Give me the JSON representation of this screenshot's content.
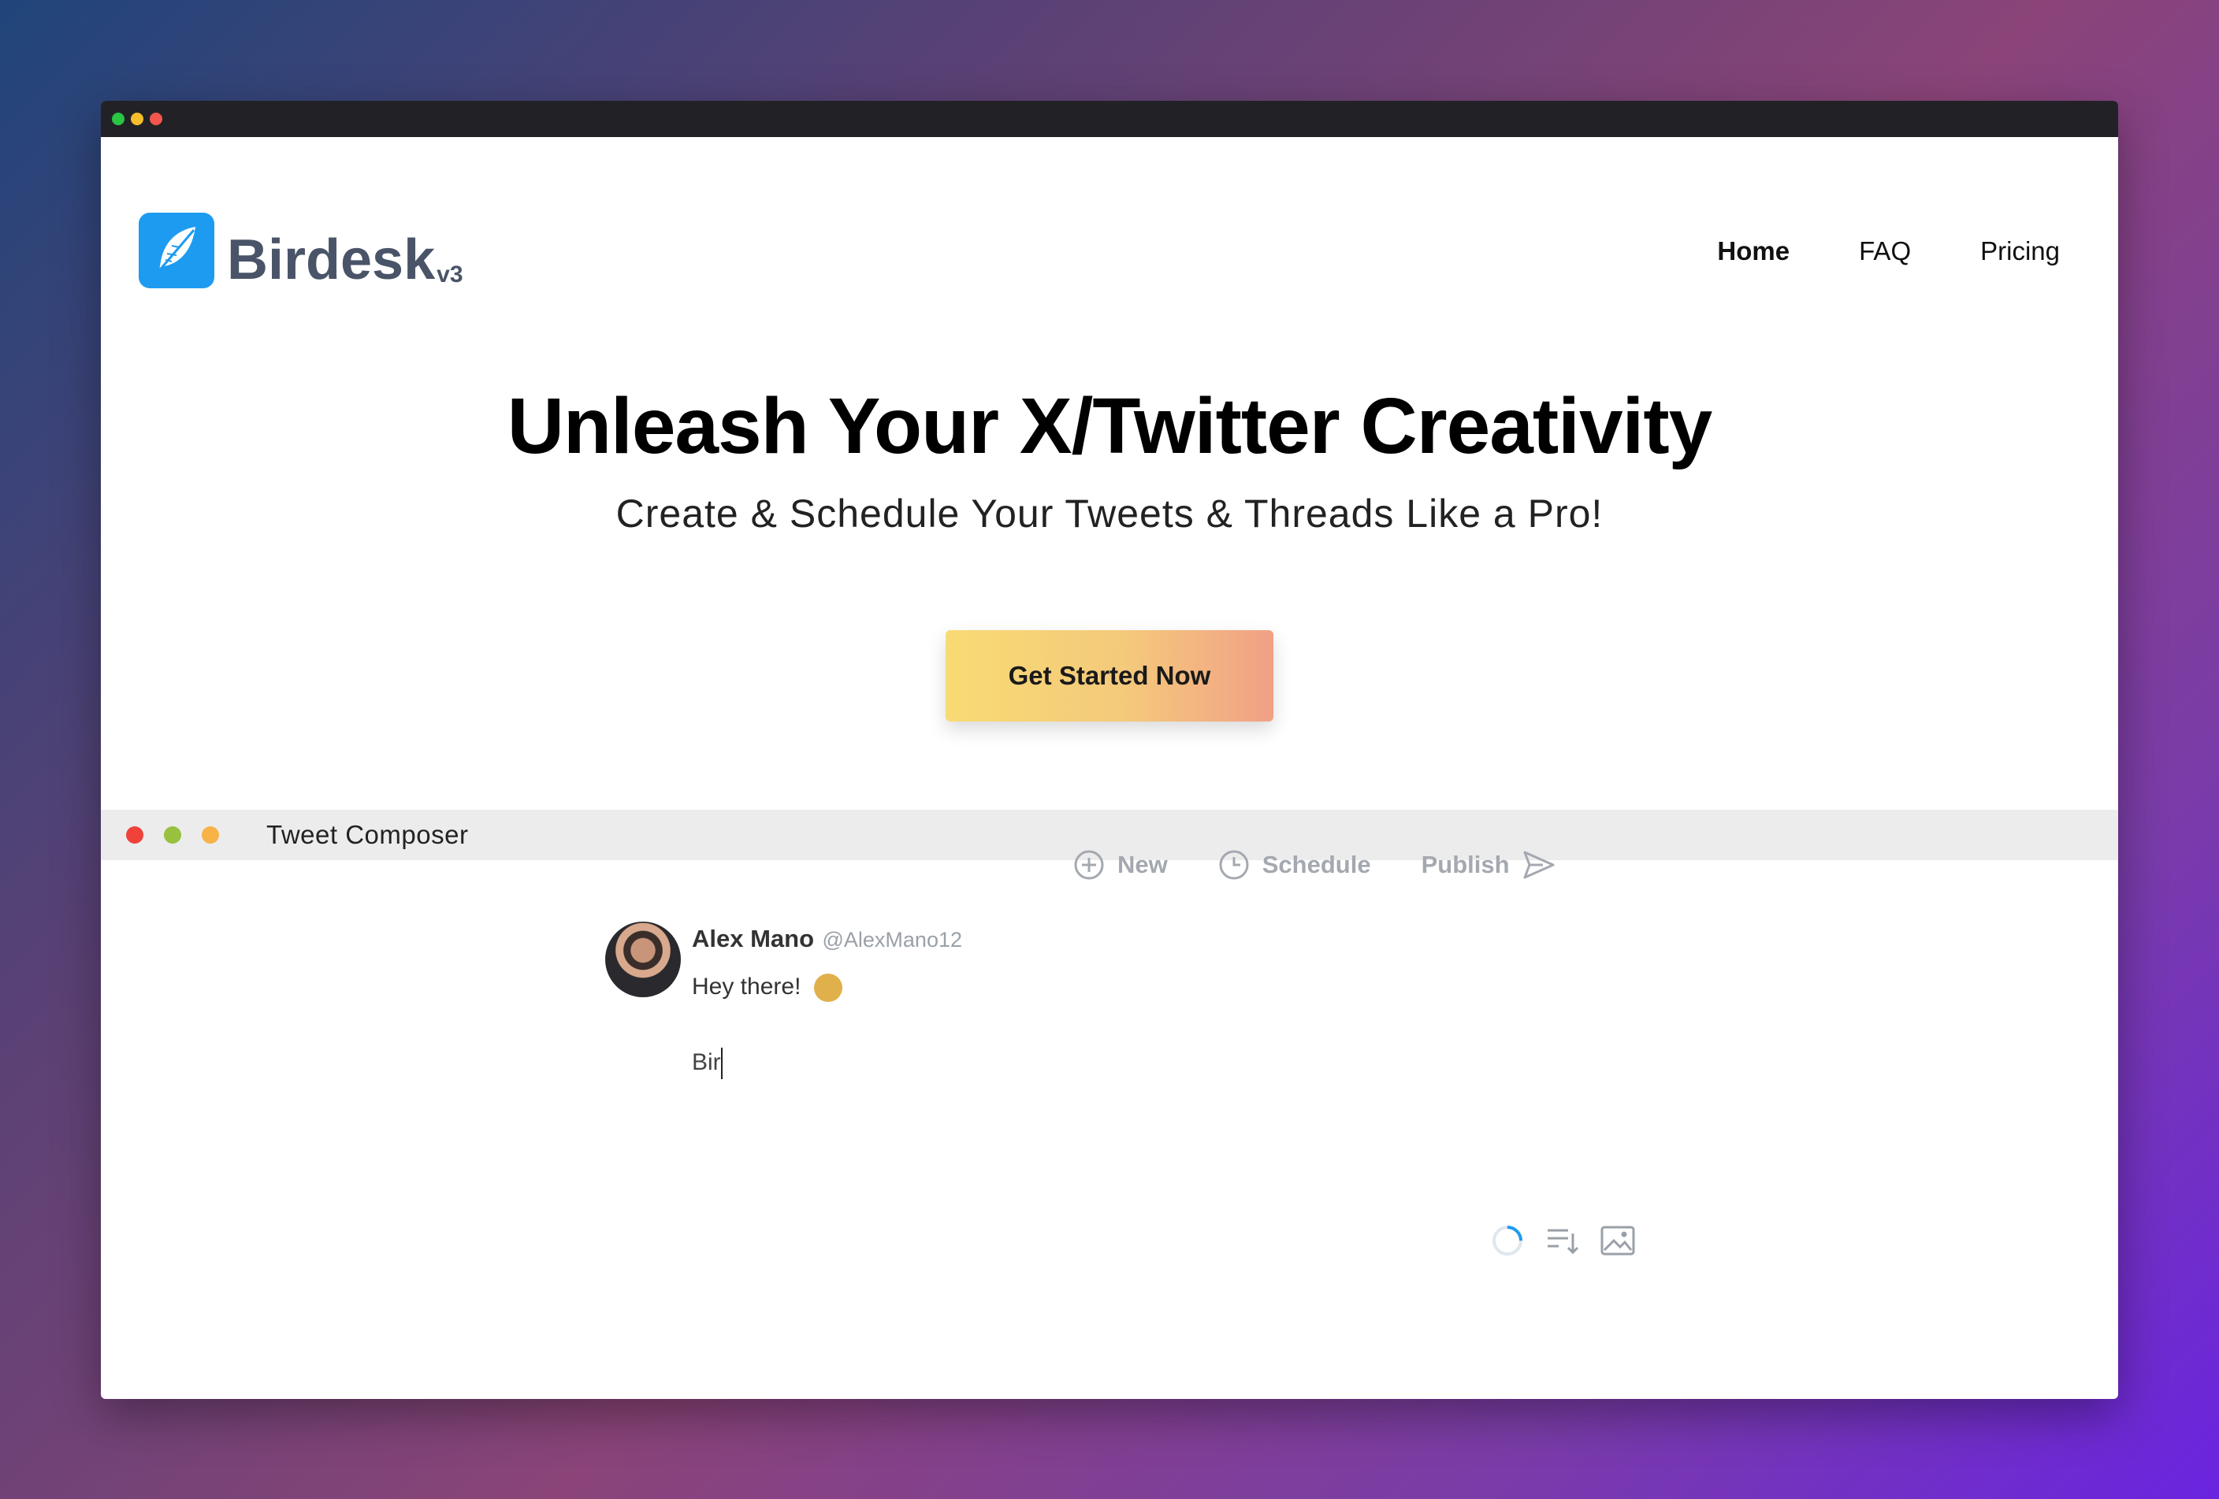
{
  "brand": {
    "name": "Birdesk",
    "version": "v3",
    "logo_icon": "feather-icon",
    "accent_color": "#1d9bf0"
  },
  "nav": {
    "items": [
      {
        "label": "Home",
        "active": true
      },
      {
        "label": "FAQ",
        "active": false
      },
      {
        "label": "Pricing",
        "active": false
      }
    ]
  },
  "hero": {
    "title": "Unleash Your X/Twitter Creativity",
    "subtitle": "Create & Schedule Your Tweets & Threads Like a Pro!",
    "cta_label": "Get Started Now"
  },
  "composer": {
    "window_title": "Tweet Composer",
    "toolbar": [
      {
        "label": "New",
        "icon": "plus-circle-icon"
      },
      {
        "label": "Schedule",
        "icon": "clock-icon"
      },
      {
        "label": "Publish",
        "icon": "send-icon"
      }
    ],
    "tweet": {
      "name": "Alex Mano",
      "handle": "@AlexMano12",
      "text": "Hey there!",
      "emoji": "clapping-hands-emoji",
      "input_value": "Bir"
    },
    "actions": [
      "progress-ring-icon",
      "thread-sort-icon",
      "image-icon"
    ]
  },
  "colors": {
    "cta_gradient_start": "#f8db74",
    "cta_gradient_end": "#f1a086",
    "toolbar_text": "#a4a8b0"
  }
}
